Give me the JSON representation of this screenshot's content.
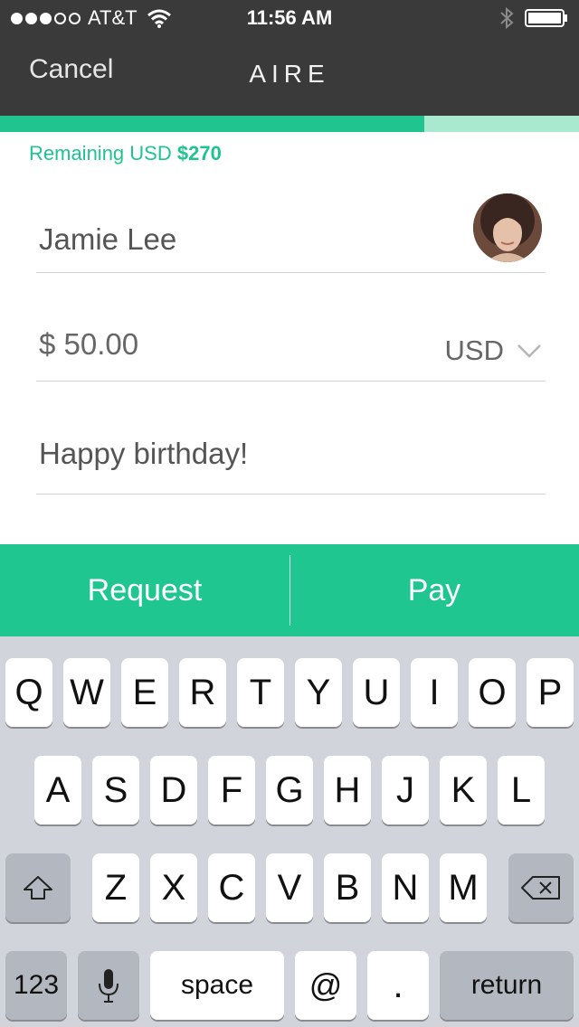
{
  "status_bar": {
    "carrier": "AT&T",
    "time": "11:56 AM"
  },
  "nav": {
    "cancel_label": "Cancel",
    "title": "AIRE"
  },
  "progress": {
    "fraction": 0.733
  },
  "remaining": {
    "label": "Remaining USD",
    "amount": "$270"
  },
  "form": {
    "recipient": "Jamie Lee",
    "amount": "$ 50.00",
    "currency": "USD",
    "note": "Happy birthday!"
  },
  "actions": {
    "request_label": "Request",
    "pay_label": "Pay"
  },
  "keyboard": {
    "row1": [
      "Q",
      "W",
      "E",
      "R",
      "T",
      "Y",
      "U",
      "I",
      "O",
      "P"
    ],
    "row2": [
      "A",
      "S",
      "D",
      "F",
      "G",
      "H",
      "J",
      "K",
      "L"
    ],
    "row3": [
      "Z",
      "X",
      "C",
      "V",
      "B",
      "N",
      "M"
    ],
    "numbers_label": "123",
    "space_label": "space",
    "at_label": "@",
    "period_label": ".",
    "return_label": "return"
  },
  "colors": {
    "accent": "#1fc48f",
    "header_bg": "#3a3a3a",
    "progress_track": "#a9e9d0",
    "keyboard_bg": "#d1d5db"
  }
}
